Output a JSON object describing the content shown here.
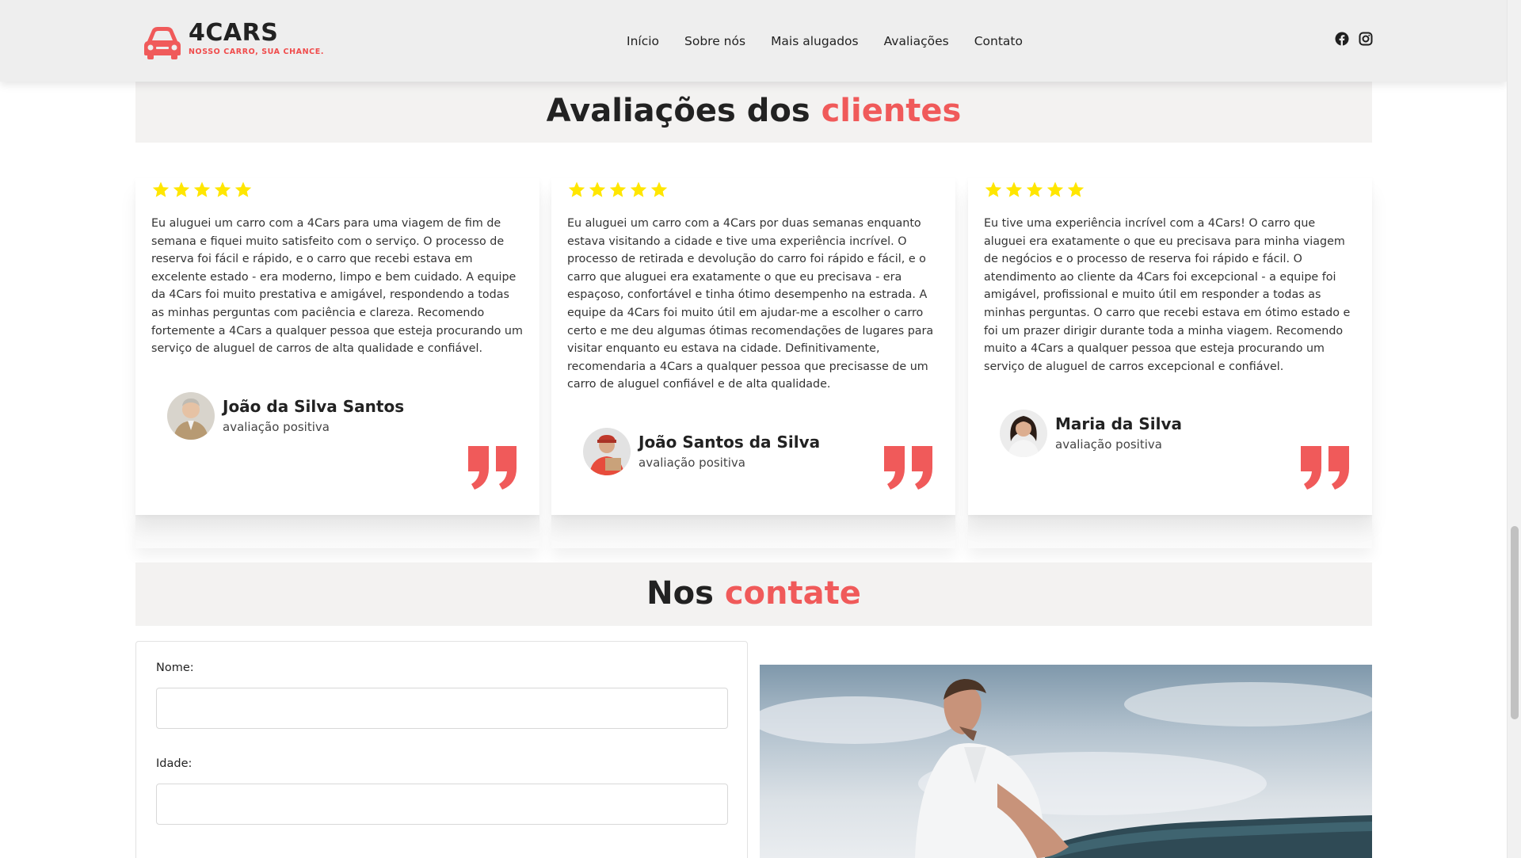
{
  "brand": {
    "name": "4CARS",
    "tagline": "NOSSO CARRO, SUA CHANCE.",
    "accent_color": "#f05a5a",
    "star_color": "#ffe600"
  },
  "nav": {
    "items": [
      {
        "label": "Início"
      },
      {
        "label": "Sobre nós"
      },
      {
        "label": "Mais alugados"
      },
      {
        "label": "Avaliações"
      },
      {
        "label": "Contato"
      }
    ]
  },
  "social": {
    "icons": [
      "facebook-icon",
      "instagram-icon"
    ]
  },
  "reviews_section": {
    "title_plain": "Avaliações dos ",
    "title_accent": "clientes"
  },
  "reviews": [
    {
      "stars": 5,
      "text": "Eu aluguei um carro com a 4Cars para uma viagem de fim de semana e fiquei muito satisfeito com o serviço. O processo de reserva foi fácil e rápido, e o carro que recebi estava em excelente estado - era moderno, limpo e bem cuidado. A equipe da 4Cars foi muito prestativa e amigável, respondendo a todas as minhas perguntas com paciência e clareza. Recomendo fortemente a 4Cars a qualquer pessoa que esteja procurando um serviço de aluguel de carros de alta qualidade e confiável.",
      "name": "João da Silva Santos",
      "role": "avaliação positiva"
    },
    {
      "stars": 5,
      "text": "Eu aluguei um carro com a 4Cars por duas semanas enquanto estava visitando a cidade e tive uma experiência incrível. O processo de retirada e devolução do carro foi rápido e fácil, e o carro que aluguei era exatamente o que eu precisava - era espaçoso, confortável e tinha ótimo desempenho na estrada. A equipe da 4Cars foi muito útil em ajudar-me a escolher o carro certo e me deu algumas ótimas recomendações de lugares para visitar enquanto eu estava na cidade. Definitivamente, recomendaria a 4Cars a qualquer pessoa que precisasse de um carro de aluguel confiável e de alta qualidade.",
      "name": "João Santos da Silva",
      "role": "avaliação positiva"
    },
    {
      "stars": 5,
      "text": "Eu tive uma experiência incrível com a 4Cars! O carro que aluguei era exatamente o que eu precisava para minha viagem de negócios e o processo de reserva foi rápido e fácil. O atendimento ao cliente da 4Cars foi excepcional - a equipe foi amigável, profissional e muito útil em responder a todas as minhas perguntas. O carro que recebi estava em ótimo estado e foi um prazer dirigir durante toda a minha viagem. Recomendo muito a 4Cars a qualquer pessoa que esteja procurando um serviço de aluguel de carros excepcional e confiável.",
      "name": "Maria da Silva",
      "role": "avaliação positiva"
    }
  ],
  "contact_section": {
    "title_plain": "Nos ",
    "title_accent": "contate"
  },
  "form": {
    "name_label": "Nome:",
    "name_value": "",
    "age_label": "Idade:",
    "age_value": ""
  }
}
